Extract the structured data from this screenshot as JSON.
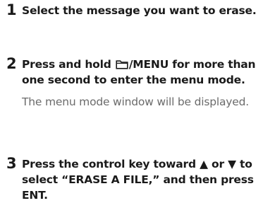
{
  "steps": [
    {
      "number": "1",
      "instruction": "Select the message you want to erase."
    },
    {
      "number": "2",
      "instruction_before_icon": "Press and hold ",
      "icon": "folder-icon",
      "instruction_after_icon": "/MENU for more than one second to enter the menu mode.",
      "note": "The menu mode window will be displayed."
    },
    {
      "number": "3",
      "instruction": "Press the control key toward ▲ or ▼ to select “ERASE A FILE,” and then press ENT."
    }
  ],
  "colors": {
    "instruction_text": "#1a1a1a",
    "note_text": "#6b6b6b"
  }
}
